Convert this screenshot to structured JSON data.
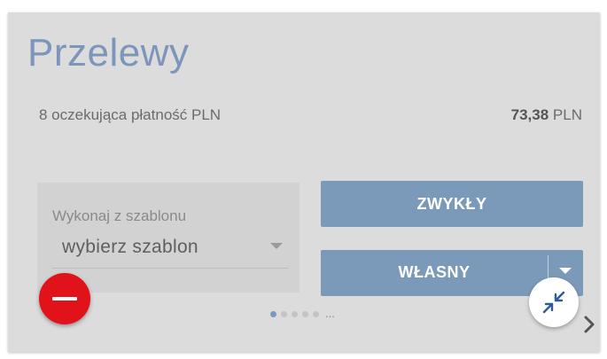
{
  "card": {
    "title": "Przelewy",
    "pending_text": "8 oczekująca płatność PLN",
    "amount_value": "73,38",
    "amount_currency": "PLN"
  },
  "template": {
    "label": "Wykonaj z szablonu",
    "selected": "wybierz szablon"
  },
  "buttons": {
    "zwykly": "ZWYKŁY",
    "wlasny": "WŁASNY"
  },
  "pager": {
    "page_count": 5,
    "active_index": 0,
    "more": "..."
  },
  "icons": {
    "minus_fab": "minus-icon",
    "collapse_fab": "collapse-arrows-icon",
    "next": "chevron-right-icon"
  },
  "colors": {
    "title": "#7b96ba",
    "accent_button": "#7b9ab9",
    "fab_red": "#e2121a",
    "card_bg": "#dcdcdc",
    "collapse_icon": "#2b5a9e"
  }
}
